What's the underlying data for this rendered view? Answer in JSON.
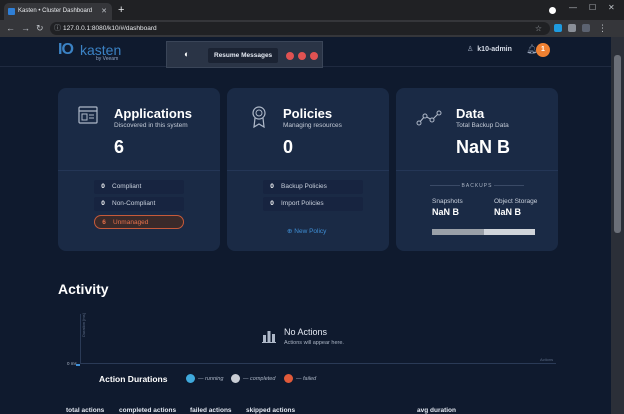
{
  "browser": {
    "tab_title": "Kasten • Cluster Dashboard",
    "url": "127.0.0.1:8080/k10/#/dashboard"
  },
  "nav": {
    "logo_mark": "IO",
    "logo_word": "kasten",
    "logo_sub": "by Veeam",
    "resume_label": "Resume Messages",
    "user": "k10-admin",
    "notifications": "1"
  },
  "cards": {
    "applications": {
      "title": "Applications",
      "subtitle": "Discovered in this system",
      "count": "6",
      "stats": [
        {
          "value": "0",
          "label": "Compliant"
        },
        {
          "value": "0",
          "label": "Non-Compliant"
        },
        {
          "value": "6",
          "label": "Unmanaged"
        }
      ]
    },
    "policies": {
      "title": "Policies",
      "subtitle": "Managing resources",
      "count": "0",
      "stats": [
        {
          "value": "0",
          "label": "Backup Policies"
        },
        {
          "value": "0",
          "label": "Import Policies"
        }
      ],
      "new_policy": "New Policy"
    },
    "data": {
      "title": "Data",
      "subtitle": "Total Backup Data",
      "total": "NaN B",
      "backups_label": "BACKUPS",
      "snapshots_label": "Snapshots",
      "snapshots_value": "NaN B",
      "object_storage_label": "Object Storage",
      "object_storage_value": "NaN B",
      "usage_fraction": 0.5
    }
  },
  "activity": {
    "title": "Activity",
    "y_label": "Duration [ms]",
    "x_label": "Actions",
    "zero": "0 ms",
    "empty_title": "No Actions",
    "empty_sub": "Actions will appear here."
  },
  "durations": {
    "title": "Action Durations",
    "legend": [
      {
        "label": "— running",
        "color": "#3fa9dc"
      },
      {
        "label": "— completed",
        "color": "#c9cdd4"
      },
      {
        "label": "— failed",
        "color": "#e05a3a"
      }
    ],
    "columns": [
      "total actions",
      "completed actions",
      "failed actions",
      "skipped actions",
      "avg duration"
    ]
  }
}
